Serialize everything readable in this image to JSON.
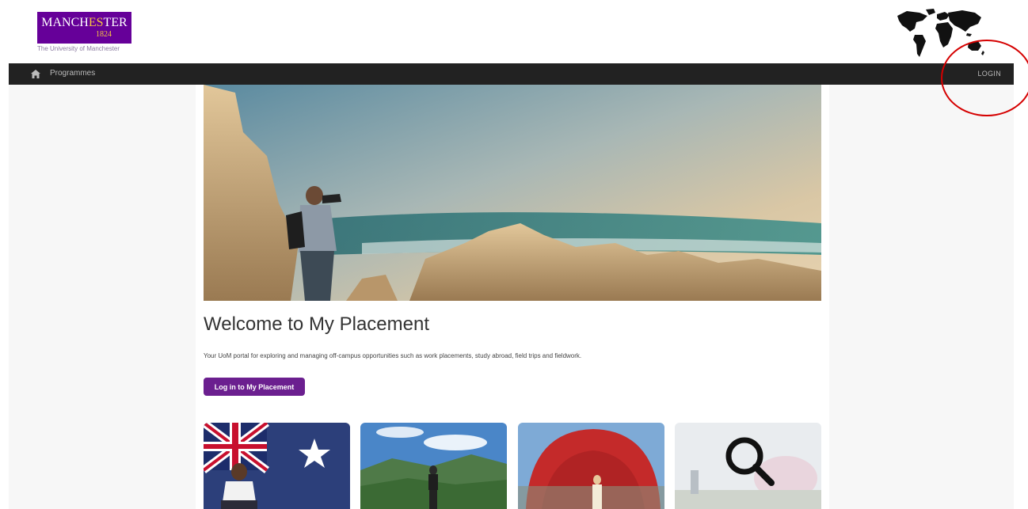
{
  "brand": {
    "logo_word_1": "MANCH",
    "logo_word_accent": "ES",
    "logo_word_2": "TER",
    "logo_year": "1824",
    "logo_sub": "The University of Manchester"
  },
  "nav": {
    "home_icon": "home-icon",
    "programmes_label": "Programmes",
    "login_label": "LOGIN"
  },
  "main": {
    "title": "Welcome to My Placement",
    "intro": "Your UoM portal for exploring and managing off-campus opportunities such as work placements, study abroad, field trips and fieldwork.",
    "cta_label": "Log in to My Placement"
  },
  "cards": [
    {
      "name": "australia-flag-card"
    },
    {
      "name": "mountain-hike-card"
    },
    {
      "name": "red-dome-card"
    },
    {
      "name": "search-card"
    }
  ],
  "colors": {
    "brand_purple": "#660099",
    "accent_gold": "#f5c542",
    "navbar": "#222222",
    "cta": "#6b1f8f",
    "annotation": "#d50000"
  }
}
